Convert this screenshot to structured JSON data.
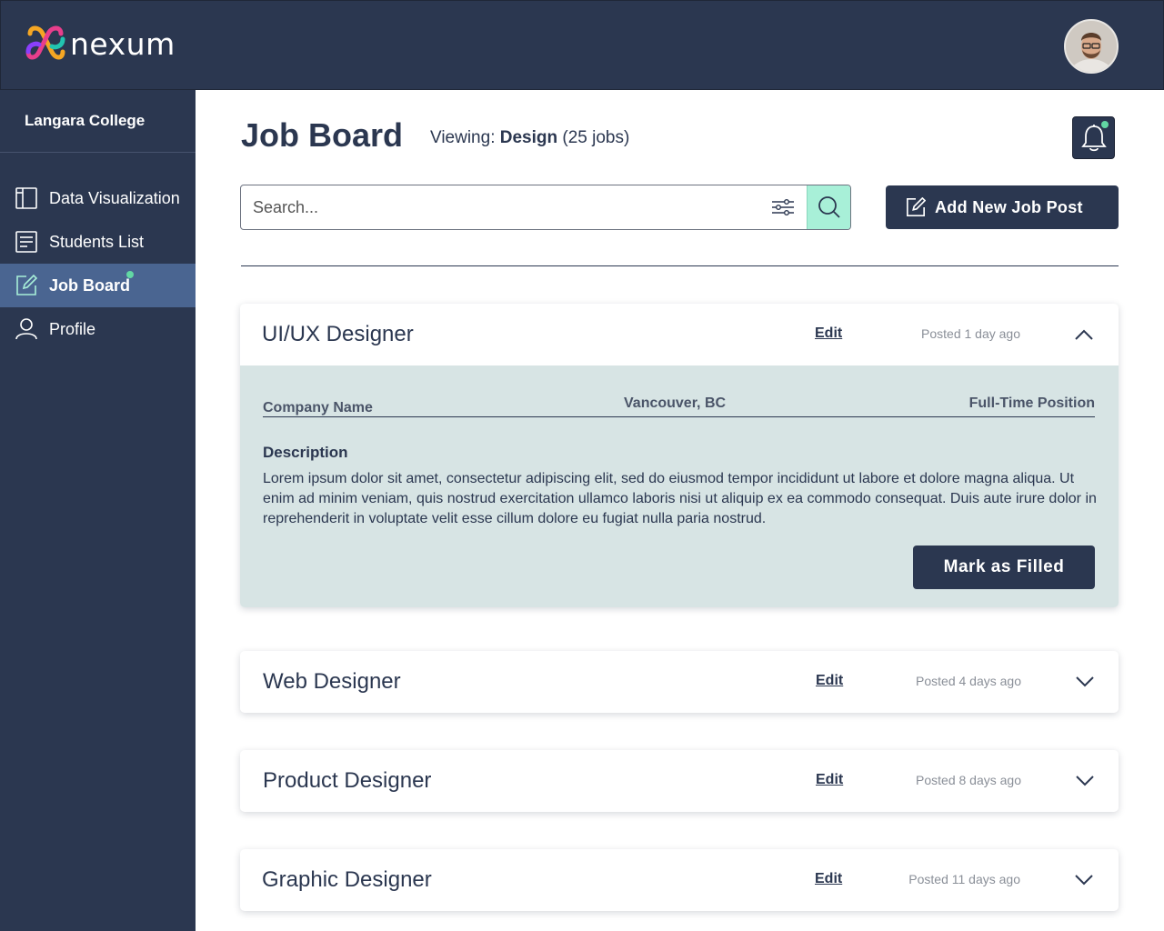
{
  "app": {
    "logo_text": "nexum",
    "brand_colors": [
      "#f5a623",
      "#e83e8c",
      "#8a3ffc",
      "#22c4b0"
    ]
  },
  "sidebar": {
    "org_name": "Langara College",
    "items": [
      {
        "label": "Data Visualization",
        "icon": "layout-icon",
        "active": false
      },
      {
        "label": "Students List",
        "icon": "list-icon",
        "active": false
      },
      {
        "label": "Job Board",
        "icon": "edit-icon",
        "active": true,
        "badge": true
      },
      {
        "label": "Profile",
        "icon": "user-icon",
        "active": false
      }
    ]
  },
  "header": {
    "title": "Job Board",
    "viewing_prefix": "Viewing: ",
    "viewing_category": "Design",
    "viewing_count": " (25 jobs)"
  },
  "search": {
    "placeholder": "Search...",
    "value": ""
  },
  "actions": {
    "add_job_label": "Add New Job Post"
  },
  "jobs": [
    {
      "title": "UI/UX Designer",
      "edit_label": "Edit",
      "posted": "Posted 1 day ago",
      "expanded": true,
      "company": "Company Name",
      "location": "Vancouver, BC",
      "type": "Full-Time Position",
      "description_label": "Description",
      "description": "Lorem ipsum dolor sit amet, consectetur adipiscing elit, sed do eiusmod tempor incididunt ut labore et dolore magna aliqua. Ut enim ad minim veniam, quis nostrud exercitation ullamco laboris nisi ut aliquip ex ea commodo consequat. Duis aute irure dolor in reprehenderit in voluptate velit esse cillum dolore eu fugiat nulla paria nostrud.",
      "action_label": "Mark as Filled"
    },
    {
      "title": "Web Designer",
      "edit_label": "Edit",
      "posted": "Posted 4 days ago",
      "expanded": false
    },
    {
      "title": "Product Designer",
      "edit_label": "Edit",
      "posted": "Posted 8 days ago",
      "expanded": false
    },
    {
      "title": "Graphic Designer",
      "edit_label": "Edit",
      "posted": "Posted 11 days ago",
      "expanded": false
    }
  ],
  "colors": {
    "navy": "#2b3750",
    "active_nav": "#4a6591",
    "accent_green": "#62d8a4",
    "search_button": "#a8f0d8",
    "details_bg": "#d7e4e4"
  }
}
